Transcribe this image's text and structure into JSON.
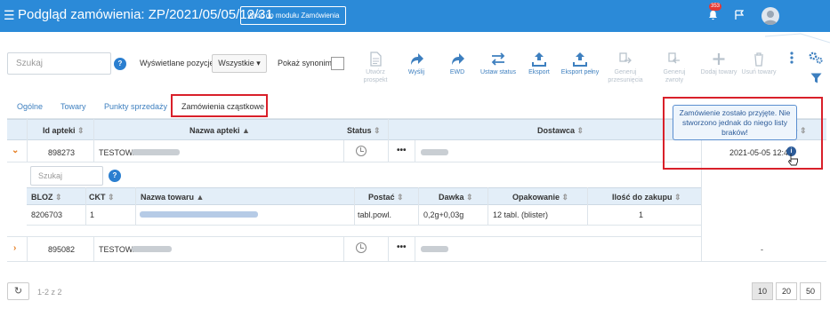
{
  "header": {
    "title": "Podgląd zamówienia: ZP/2021/05/05/12/31",
    "back_button": "Wróć do modułu Zamówienia",
    "notifications_count": "353"
  },
  "toolbar": {
    "search_placeholder": "Szukaj",
    "positions_label": "Wyświetlane pozycje",
    "positions_value": "Wszystkie",
    "synonyms_label": "Pokaż synonimy",
    "actions": [
      {
        "label": "Utwórz prospekt",
        "icon": "document-icon",
        "enabled": false
      },
      {
        "label": "Wyślij",
        "icon": "send-icon",
        "enabled": true
      },
      {
        "label": "EWD",
        "icon": "ewd-icon",
        "enabled": true
      },
      {
        "label": "Ustaw status",
        "icon": "swap-icon",
        "enabled": true
      },
      {
        "label": "Eksport",
        "icon": "upload-icon",
        "enabled": true
      },
      {
        "label": "Eksport pełny",
        "icon": "upload-full-icon",
        "enabled": true
      },
      {
        "label": "Generuj przesunięcia",
        "icon": "generate-shift-icon",
        "enabled": false
      },
      {
        "label": "Generuj zwroty",
        "icon": "generate-return-icon",
        "enabled": false
      },
      {
        "label": "Dodaj towary",
        "icon": "plus-icon",
        "enabled": false
      },
      {
        "label": "Usuń towary",
        "icon": "trash-icon",
        "enabled": false
      }
    ]
  },
  "tabs": [
    "Ogólne",
    "Towary",
    "Punkty sprzedaży",
    "Zamówienia cząstkowe"
  ],
  "active_tab": "Zamówienia cząstkowe",
  "table": {
    "columns": [
      "Id apteki",
      "Nazwa apteki",
      "Status",
      "Dostawca",
      "D"
    ],
    "rows": [
      {
        "id": "898273",
        "name": "TESTOWA",
        "date": "2021-05-05 12:46"
      },
      {
        "id": "895082",
        "name": "TESTOWA",
        "date": "-"
      }
    ]
  },
  "subtable": {
    "search_placeholder": "Szukaj",
    "columns": [
      "BLOZ",
      "CKT",
      "Nazwa towaru",
      "Postać",
      "Dawka",
      "Opakowanie",
      "Ilość do zakupu"
    ],
    "rows": [
      {
        "bloz": "8206703",
        "ckt": "1",
        "postac": "tabl.powl.",
        "dawka": "0,2g+0,03g",
        "opakowanie": "12 tabl. (blister)",
        "ilosc": "1"
      }
    ]
  },
  "tooltip": "Zamówienie zostało przyjęte. Nie stworzono jednak do niego listy braków!",
  "pagination": {
    "summary": "1-2 z 2",
    "sizes": [
      "10",
      "20",
      "50"
    ],
    "active_size": "10"
  },
  "colors": {
    "header": "#2b8ad8",
    "accent": "#3d7fbf",
    "highlight": "#d9202a",
    "row_chevron": "#e67e22"
  }
}
